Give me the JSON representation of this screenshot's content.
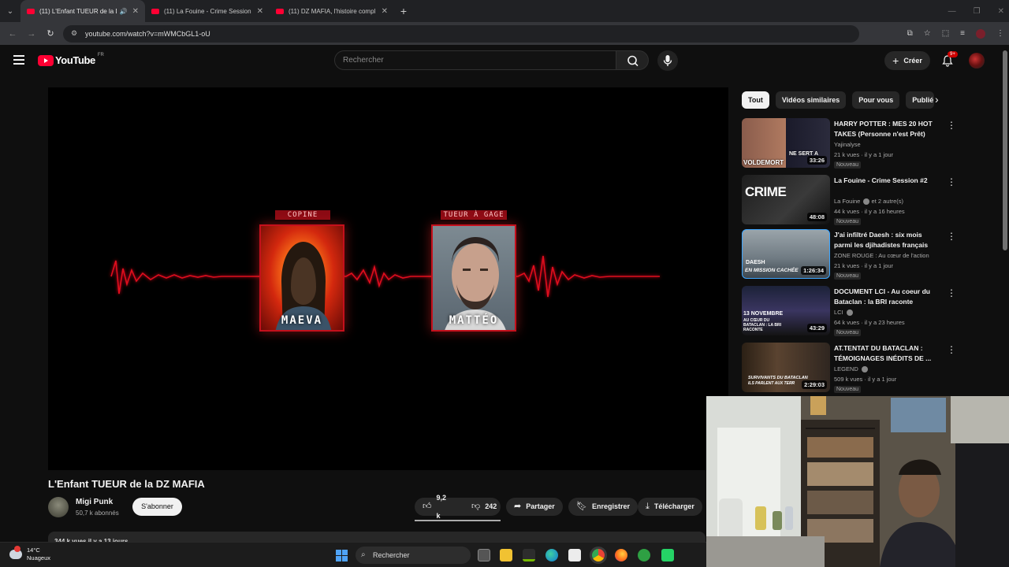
{
  "browser": {
    "tabs": [
      {
        "title": "(11) L'Enfant TUEUR de la D",
        "active": true
      },
      {
        "title": "(11) La Fouine - Crime Session",
        "active": false
      },
      {
        "title": "(11) DZ MAFIA, l'histoire compl",
        "active": false
      }
    ],
    "url": "youtube.com/watch?v=mWMCbGL1-oU"
  },
  "youtube": {
    "logo_text": "YouTube",
    "country": "FR",
    "search_placeholder": "Rechercher",
    "create_label": "Créer",
    "notif_count": "9+"
  },
  "player": {
    "cards": [
      {
        "tag": "COPINE",
        "name": "MAEVA"
      },
      {
        "tag": "TUEUR À GAGE",
        "name": "MATTÉO"
      }
    ]
  },
  "video": {
    "title": "L'Enfant TUEUR de la DZ MAFIA",
    "channel": "Migi Punk",
    "subscribers": "50,7 k abonnés",
    "subscribe_label": "S'abonner",
    "likes": "9,2 k",
    "dislikes": "242",
    "share_label": "Partager",
    "save_label": "Enregistrer",
    "download_label": "Télécharger",
    "description_peek": "344 k vues  il y a 13 jours"
  },
  "sidebar": {
    "chips": [
      "Tout",
      "Vidéos similaires",
      "Pour vous",
      "Publié"
    ],
    "recommendations": [
      {
        "title": "HARRY POTTER : MES 20 HOT TAKES (Personne n'est Prêt)",
        "channel": "Yajinalyse",
        "meta": "21 k vues · il y a 1 jour",
        "badge": "Nouveau",
        "duration": "33:26",
        "thumb_texts": [
          "VOLDEMORT",
          "NE SERT A"
        ]
      },
      {
        "title": "La Fouine - Crime Session #2",
        "channel": "La Fouine",
        "channel_extra": "et 2 autre(s)",
        "meta": "44 k vues · il y a 16 heures",
        "badge": "Nouveau",
        "duration": "48:08",
        "thumb_texts": [
          "CRIME"
        ]
      },
      {
        "title": "J'ai infiltré Daesh : six mois parmi les djihadistes français",
        "channel": "ZONE ROUGE : Au cœur de l'action",
        "meta": "21 k vues · il y a 1 jour",
        "badge": "Nouveau",
        "duration": "1:26:34",
        "thumb_texts": [
          "DAESH",
          "EN MISSION CACHÉE"
        ]
      },
      {
        "title": "DOCUMENT LCI - Au coeur du Bataclan : la BRI raconte",
        "channel": "LCI",
        "meta": "64 k vues · il y a 23 heures",
        "badge": "Nouveau",
        "duration": "43:29",
        "thumb_texts": [
          "13 NOVEMBRE",
          "AU CŒUR DU BATACLAN : LA BRI RACONTE"
        ]
      },
      {
        "title": "AT.TENTAT DU BATACLAN : TÉMOIGNAGES INÉDITS DE ...",
        "channel": "LEGEND",
        "meta": "509 k vues · il y a 1 jour",
        "badge": "Nouveau",
        "duration": "2:29:03",
        "thumb_texts": [
          "SURVIVANTS DU BATACLAN",
          "ILS PARLENT AUX TERR"
        ]
      }
    ]
  },
  "taskbar": {
    "weather_temp": "14°C",
    "weather_desc": "Nuageux",
    "search_label": "Rechercher"
  },
  "colors": {
    "yt_red": "#ff0033",
    "ecg_red": "#e0101e",
    "background": "#0f0f0f"
  }
}
